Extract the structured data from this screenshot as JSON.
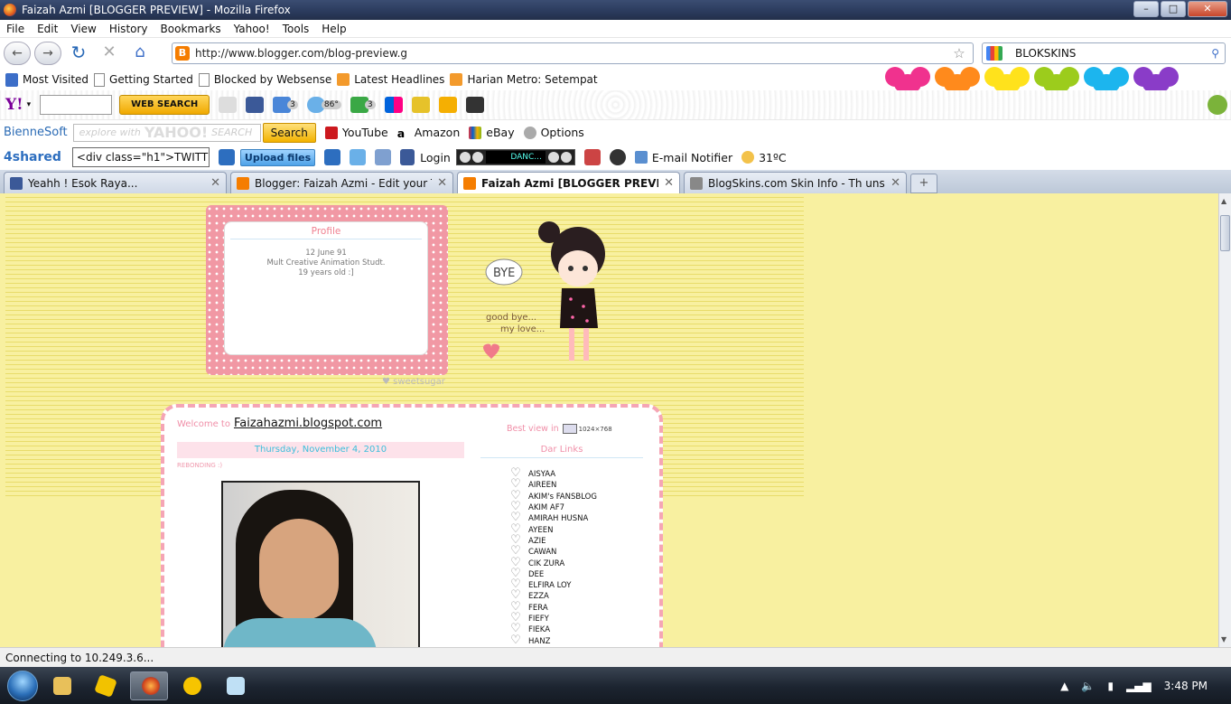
{
  "window": {
    "title": "Faizah Azmi [BLOGGER PREVIEW] - Mozilla Firefox",
    "min": "–",
    "max": "□",
    "close": "✕"
  },
  "menu": [
    "File",
    "Edit",
    "View",
    "History",
    "Bookmarks",
    "Yahoo!",
    "Tools",
    "Help"
  ],
  "nav": {
    "url": "http://www.blogger.com/blog-preview.g",
    "search_value": "BLOKSKINS"
  },
  "bookmarks": [
    "Most Visited",
    "Getting Started",
    "Blocked by Websense",
    "Latest Headlines",
    "Harian Metro: Setempat"
  ],
  "mickey_colors": [
    "#f0328e",
    "#ff8a1c",
    "#ffe21c",
    "#9ccc1c",
    "#1cb5ee",
    "#8a3cc8"
  ],
  "yahoo_toolbar": {
    "logo": "Y!",
    "web_search": "WEB SEARCH",
    "mail_count": "3",
    "weather": "86°",
    "updates_count": "3"
  },
  "bienne_toolbar": {
    "brand": "BienneSoft",
    "search_placeholder_a": "explore with",
    "search_placeholder_b": "YAHOO!",
    "search_placeholder_c": "SEARCH",
    "search_button": "Search",
    "links": [
      "YouTube",
      "Amazon",
      "eBay",
      "Options"
    ]
  },
  "shared_toolbar": {
    "brand": "4shared",
    "select_value": "<div class=\"h1\">TWITT",
    "upload": "Upload files",
    "login": "Login",
    "player_text": "DANC...",
    "email": "E-mail Notifier",
    "temp": "31ºC"
  },
  "tabs": [
    {
      "label": "Yeahh ! Esok Raya...",
      "color": "#3b5998",
      "active": false
    },
    {
      "label": "Blogger: Faizah Azmi - Edit your Te...",
      "color": "#f57d00",
      "active": false
    },
    {
      "label": "Faizah Azmi [BLOGGER PREVIEW]",
      "color": "#f57d00",
      "active": true
    },
    {
      "label": "BlogSkins.com Skin Info - Th unsep...",
      "color": "#888888",
      "active": false
    }
  ],
  "profile": {
    "title": "Profile",
    "lines": [
      "12 June 91",
      "Mult Creative Animation Studt.",
      "19 years old :]"
    ],
    "credit": "♥ sweetsugar"
  },
  "girl": {
    "bubble": "BYE",
    "caption_1": "good bye...",
    "caption_2": "my love..."
  },
  "blog": {
    "welcome": "Welcome to",
    "blog_link": "Faizahazmi.blogspot.com",
    "date": "Thursday, November 4, 2010",
    "post_label": "REBONDING :)",
    "best_view": "Best view in",
    "resolution": "1024×768",
    "links_title": "Dar Links",
    "links": [
      "AISYAA",
      "AIREEN",
      "AKIM's FANSBLOG",
      "AKIM AF7",
      "AMIRAH HUSNA",
      "AYEEN",
      "AZIE",
      "CAWAN",
      "CIK ZURA",
      "DEE",
      "ELFIRA LOY",
      "EZZA",
      "FERA",
      "FIEFY",
      "FIEKA",
      "HANZ"
    ]
  },
  "status": "Connecting to 10.249.3.6...",
  "clock": "3:48 PM",
  "colors": {
    "page_bg": "#f8f0a0",
    "accent_pink": "#f08fa8",
    "blogger_orange": "#f57d00"
  }
}
